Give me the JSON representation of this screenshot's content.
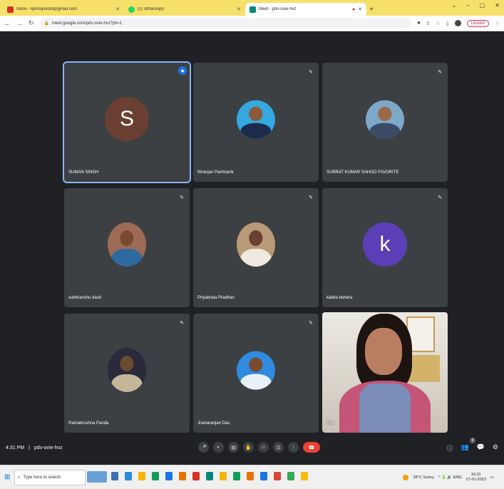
{
  "browser": {
    "tabs": [
      {
        "title": "Inbox - lipmoljokoto@gmail.com",
        "favicon_color": "#d93025",
        "active": false
      },
      {
        "title": "(1) WhatsApp",
        "favicon_color": "#25d366",
        "active": false
      },
      {
        "title": "Meet - pdv-ovie-hvz",
        "favicon_color": "#00897b",
        "active": true
      }
    ],
    "new_tab": "+",
    "window_controls": [
      "⌄",
      "–",
      "▢",
      "✕"
    ],
    "url": "meet.google.com/pdv-ovie-hvz?pli=1",
    "update_label": "Update"
  },
  "meet": {
    "tiles": [
      {
        "name": "SUMAN SINGH",
        "kind": "letter",
        "letter": "S",
        "color": "#6b4033",
        "speaking": true
      },
      {
        "name": "Niranjan Parimanik",
        "kind": "photo",
        "bg": "#35a8e0",
        "shirt": "#1d2a4d"
      },
      {
        "name": "SUBRAT KUMAR SAHOO FAVORITE",
        "kind": "photo",
        "bg": "#7ea8c8",
        "shirt": "#3b4b66"
      },
      {
        "name": "subhranshu dash",
        "kind": "photo",
        "bg": "#9c6a55",
        "shirt": "#2d6aa0"
      },
      {
        "name": "Priyabrata Pradhan",
        "kind": "photo",
        "bg": "#b89a76",
        "shirt": "#efe9df"
      },
      {
        "name": "kabita behera",
        "kind": "letter",
        "letter": "k",
        "color": "#5b3fb6",
        "speaking": false
      },
      {
        "name": "Ramakrushna Panda",
        "kind": "photo",
        "bg": "#2b2a3a",
        "shirt": "#c4b79a"
      },
      {
        "name": "Jnanaranjan Das",
        "kind": "photo",
        "bg": "#2f8ae0",
        "shirt": "#e9f1f8"
      },
      {
        "name": "You",
        "kind": "camera"
      }
    ],
    "time": "4:31 PM",
    "separator": "|",
    "meeting_code": "pdv-ovie-hvz",
    "controls": [
      "🎤",
      "◐",
      "▤",
      "✋",
      "☺",
      "⊡",
      "⋮"
    ],
    "end_icon": "☎",
    "right_controls": [
      "ⓘ",
      "👥",
      "💬",
      "⚙"
    ],
    "participants_badge": "9"
  },
  "taskbar": {
    "search_placeholder": "Type here to search",
    "weather": "28°C Sunny",
    "tray_icons": "^ 🔋 🔊 ENG",
    "clock_time": "16:31",
    "clock_date": "27-01-2023",
    "app_colors": [
      "#3b6fb6",
      "#2a8ad6",
      "#f4b400",
      "#0f9d58",
      "#1a73e8",
      "#e37400",
      "#d93025",
      "#00897b",
      "#f4b400",
      "#0f9d58",
      "#e37400",
      "#1a73e8",
      "#db4437",
      "#34a853",
      "#fbbc05"
    ]
  }
}
